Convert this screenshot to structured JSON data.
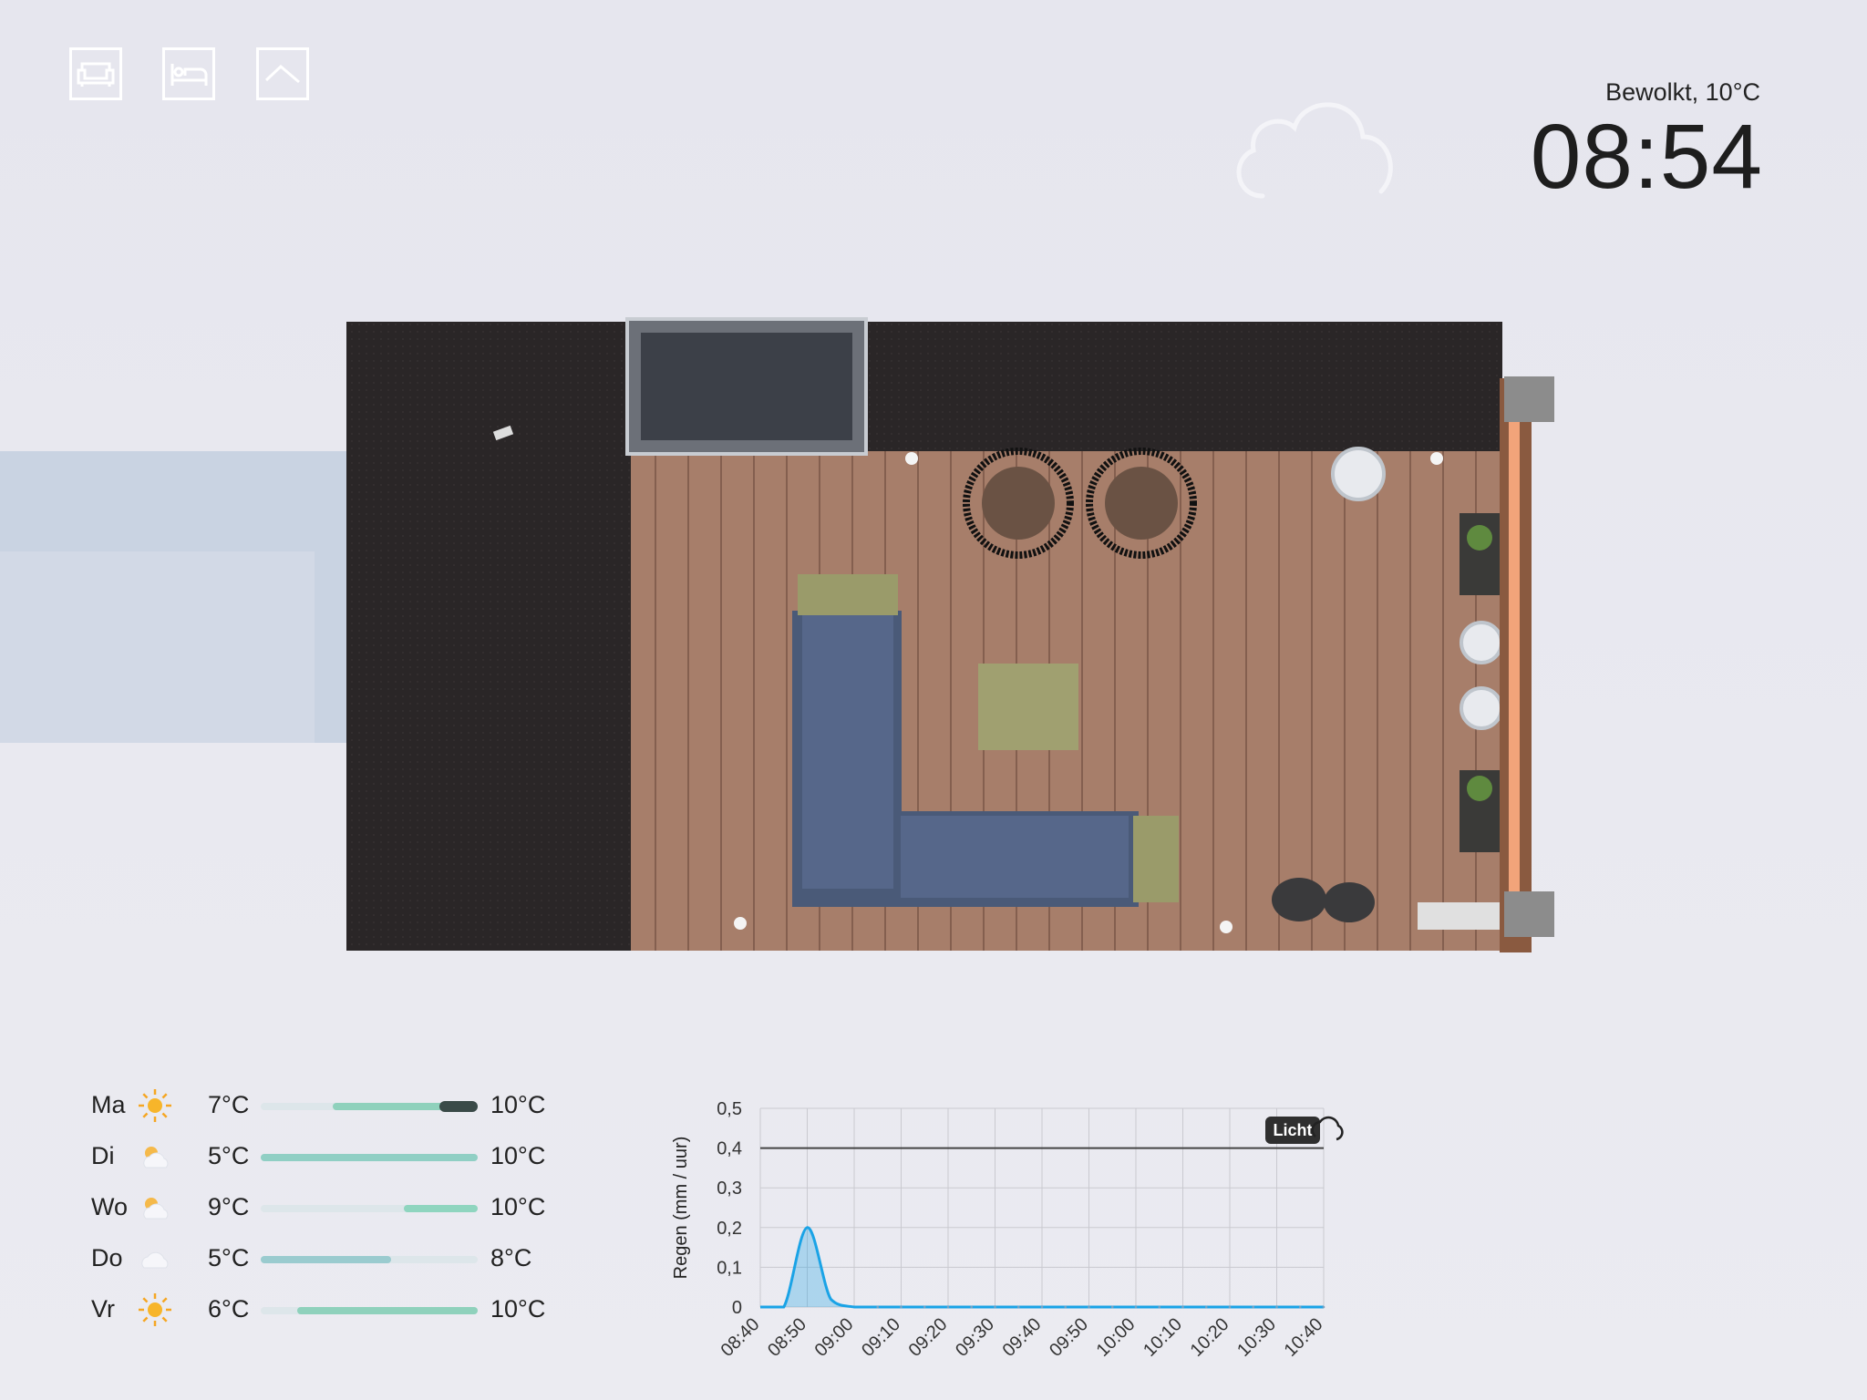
{
  "nav": {
    "items": [
      {
        "name": "living-room",
        "icon": "sofa-icon"
      },
      {
        "name": "bedroom",
        "icon": "bed-icon"
      },
      {
        "name": "outdoor",
        "icon": "landscape-icon"
      }
    ]
  },
  "header": {
    "weather_summary": "Bewolkt, 10°C",
    "time": "08:54",
    "weather_icon": "cloud-icon"
  },
  "forecast": [
    {
      "day": "Ma",
      "icon": "sun-icon",
      "min": "7°C",
      "max": "10°C",
      "bar_from": 0.33,
      "bar_to": 1.0,
      "color": "#8fd1bc",
      "now_marker": true
    },
    {
      "day": "Di",
      "icon": "partly-cloudy-icon",
      "min": "5°C",
      "max": "10°C",
      "bar_from": 0.0,
      "bar_to": 1.0,
      "color": "#90cfc4",
      "now_marker": false
    },
    {
      "day": "Wo",
      "icon": "partly-cloudy-icon",
      "min": "9°C",
      "max": "10°C",
      "bar_from": 0.66,
      "bar_to": 1.0,
      "color": "#8fd5bf",
      "now_marker": false
    },
    {
      "day": "Do",
      "icon": "cloud-icon",
      "min": "5°C",
      "max": "8°C",
      "bar_from": 0.0,
      "bar_to": 0.6,
      "color": "#9acbcf",
      "now_marker": false
    },
    {
      "day": "Vr",
      "icon": "sun-icon",
      "min": "6°C",
      "max": "10°C",
      "bar_from": 0.17,
      "bar_to": 1.0,
      "color": "#8fd1bc",
      "now_marker": false
    }
  ],
  "chart_data": {
    "type": "area",
    "title": "",
    "xlabel": "",
    "ylabel": "Regen (mm / uur)",
    "x": [
      "08:40",
      "08:45",
      "08:50",
      "08:55",
      "09:00",
      "09:05",
      "09:10",
      "09:15",
      "09:20",
      "09:25",
      "09:30",
      "09:35",
      "09:40",
      "09:45",
      "09:50",
      "09:55",
      "10:00",
      "10:05",
      "10:10",
      "10:15",
      "10:20",
      "10:25",
      "10:30",
      "10:35",
      "10:40"
    ],
    "x_tick_labels": [
      "08:40",
      "08:50",
      "09:00",
      "09:10",
      "09:20",
      "09:30",
      "09:40",
      "09:50",
      "10:00",
      "10:10",
      "10:20",
      "10:30",
      "10:40"
    ],
    "series": [
      {
        "values": [
          0,
          0,
          0.2,
          0.02,
          0,
          0,
          0,
          0,
          0,
          0,
          0,
          0,
          0,
          0,
          0,
          0,
          0,
          0,
          0,
          0,
          0,
          0,
          0,
          0,
          0
        ],
        "color": "#1aa3e6"
      }
    ],
    "ylim": [
      0,
      0.5
    ],
    "y_tick_labels": [
      "0",
      "0,1",
      "0,2",
      "0,3",
      "0,4",
      "0,5"
    ],
    "threshold": {
      "value": 0.4,
      "label": "Licht",
      "icon": "rain-cloud-icon"
    },
    "grid": true
  }
}
